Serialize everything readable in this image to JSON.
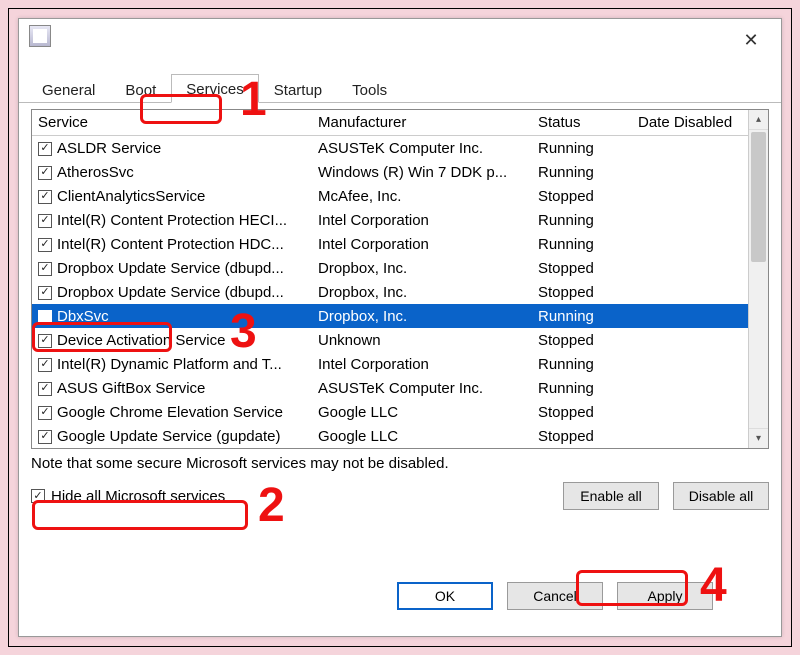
{
  "tabs": {
    "general": "General",
    "boot": "Boot",
    "services": "Services",
    "startup": "Startup",
    "tools": "Tools"
  },
  "columns": {
    "service": "Service",
    "manufacturer": "Manufacturer",
    "status": "Status",
    "date_disabled": "Date Disabled"
  },
  "rows": [
    {
      "checked": true,
      "name": "ASLDR Service",
      "mfr": "ASUSTeK Computer Inc.",
      "status": "Running",
      "date": ""
    },
    {
      "checked": true,
      "name": "AtherosSvc",
      "mfr": "Windows (R) Win 7 DDK p...",
      "status": "Running",
      "date": ""
    },
    {
      "checked": true,
      "name": "ClientAnalyticsService",
      "mfr": "McAfee, Inc.",
      "status": "Stopped",
      "date": ""
    },
    {
      "checked": true,
      "name": "Intel(R) Content Protection HECI...",
      "mfr": "Intel Corporation",
      "status": "Running",
      "date": ""
    },
    {
      "checked": true,
      "name": "Intel(R) Content Protection HDC...",
      "mfr": "Intel Corporation",
      "status": "Running",
      "date": ""
    },
    {
      "checked": true,
      "name": "Dropbox Update Service (dbupd...",
      "mfr": "Dropbox, Inc.",
      "status": "Stopped",
      "date": ""
    },
    {
      "checked": true,
      "name": "Dropbox Update Service (dbupd...",
      "mfr": "Dropbox, Inc.",
      "status": "Stopped",
      "date": ""
    },
    {
      "checked": false,
      "name": "DbxSvc",
      "mfr": "Dropbox, Inc.",
      "status": "Running",
      "date": "",
      "selected": true
    },
    {
      "checked": true,
      "name": "Device Activation Service",
      "mfr": "Unknown",
      "status": "Stopped",
      "date": ""
    },
    {
      "checked": true,
      "name": "Intel(R) Dynamic Platform and T...",
      "mfr": "Intel Corporation",
      "status": "Running",
      "date": ""
    },
    {
      "checked": true,
      "name": "ASUS GiftBox Service",
      "mfr": "ASUSTeK Computer Inc.",
      "status": "Running",
      "date": ""
    },
    {
      "checked": true,
      "name": "Google Chrome Elevation Service",
      "mfr": "Google LLC",
      "status": "Stopped",
      "date": ""
    },
    {
      "checked": true,
      "name": "Google Update Service (gupdate)",
      "mfr": "Google LLC",
      "status": "Stopped",
      "date": ""
    }
  ],
  "note": "Note that some secure Microsoft services may not be disabled.",
  "hide_ms": {
    "label": "Hide all Microsoft services",
    "checked": true
  },
  "buttons": {
    "enable_all": "Enable all",
    "disable_all": "Disable all",
    "ok": "OK",
    "cancel": "Cancel",
    "apply": "Apply"
  },
  "annotations": {
    "n1": "1",
    "n2": "2",
    "n3": "3",
    "n4": "4"
  }
}
